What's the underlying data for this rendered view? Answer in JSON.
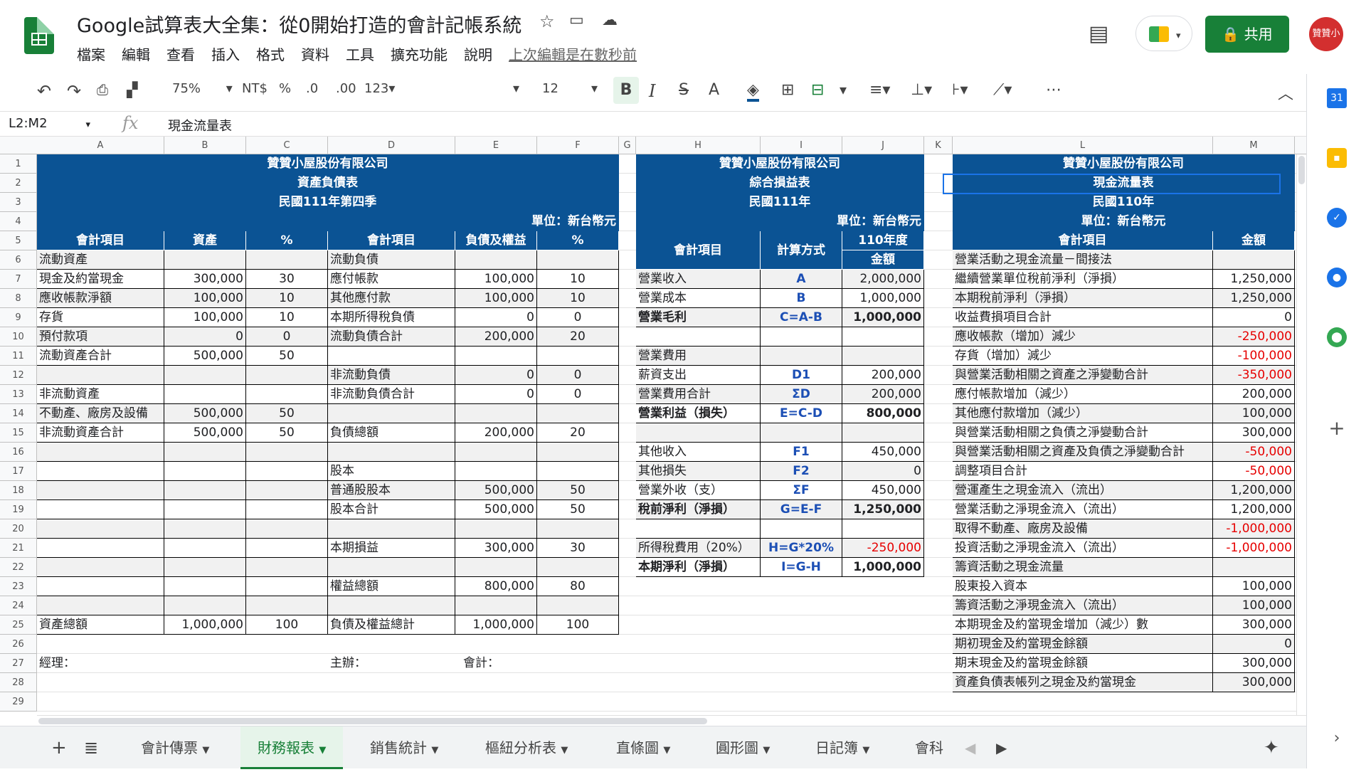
{
  "doc": {
    "title": "Google試算表大全集：從0開始打造的會計記帳系統",
    "menus": [
      "檔案",
      "編輯",
      "查看",
      "插入",
      "格式",
      "資料",
      "工具",
      "擴充功能",
      "說明"
    ],
    "last_edit": "上次編輯是在數秒前",
    "share": "共用",
    "avatar": "贊贊小屋"
  },
  "toolbar": {
    "zoom": "75%",
    "currency": "NT$",
    "percent": "%",
    "dec_less": ".0",
    "dec_more": ".00",
    "num_fmt": "123",
    "font": "",
    "font_size": "12",
    "bold": "B",
    "italic": "I",
    "strike": "S",
    "text_color": "A",
    "more": "⋯"
  },
  "formula_bar": {
    "name_box": "L2:M2",
    "fx": "fx",
    "value": "現金流量表"
  },
  "columns": [
    "A",
    "B",
    "C",
    "D",
    "E",
    "F",
    "G",
    "H",
    "I",
    "J",
    "K",
    "L",
    "M"
  ],
  "rows": [
    "1",
    "2",
    "3",
    "4",
    "5",
    "6",
    "7",
    "8",
    "9",
    "10",
    "11",
    "12",
    "13",
    "14",
    "15",
    "16",
    "17",
    "18",
    "19",
    "20",
    "21",
    "22",
    "23",
    "24",
    "25",
    "26",
    "27",
    "28",
    "29"
  ],
  "balance": {
    "company": "贊贊小屋股份有限公司",
    "title": "資產負債表",
    "period": "民國111年第四季",
    "unit": "單位：新台幣元",
    "headers": [
      "會計項目",
      "資產",
      "%",
      "會計項目",
      "負債及權益",
      "%"
    ],
    "rows": [
      [
        "流動資產",
        "",
        "",
        "流動負債",
        "",
        ""
      ],
      [
        "現金及約當現金",
        "300,000",
        "30",
        "應付帳款",
        "100,000",
        "10"
      ],
      [
        "應收帳款淨額",
        "100,000",
        "10",
        "其他應付款",
        "100,000",
        "10"
      ],
      [
        "存貨",
        "100,000",
        "10",
        "本期所得稅負債",
        "0",
        "0"
      ],
      [
        "預付款項",
        "0",
        "0",
        "流動負債合計",
        "200,000",
        "20"
      ],
      [
        "流動資產合計",
        "500,000",
        "50",
        "",
        "",
        ""
      ],
      [
        "",
        "",
        "",
        "非流動負債",
        "0",
        "0"
      ],
      [
        "非流動資產",
        "",
        "",
        "非流動負債合計",
        "0",
        "0"
      ],
      [
        "不動產、廠房及設備",
        "500,000",
        "50",
        "",
        "",
        ""
      ],
      [
        "非流動資產合計",
        "500,000",
        "50",
        "負債總額",
        "200,000",
        "20"
      ],
      [
        "",
        "",
        "",
        "",
        "",
        ""
      ],
      [
        "",
        "",
        "",
        "股本",
        "",
        ""
      ],
      [
        "",
        "",
        "",
        "普通股股本",
        "500,000",
        "50"
      ],
      [
        "",
        "",
        "",
        "股本合計",
        "500,000",
        "50"
      ],
      [
        "",
        "",
        "",
        "",
        "",
        ""
      ],
      [
        "",
        "",
        "",
        "本期損益",
        "300,000",
        "30"
      ],
      [
        "",
        "",
        "",
        "",
        "",
        ""
      ],
      [
        "",
        "",
        "",
        "權益總額",
        "800,000",
        "80"
      ],
      [
        "",
        "",
        "",
        "",
        "",
        ""
      ],
      [
        "資產總額",
        "1,000,000",
        "100",
        "負債及權益總計",
        "1,000,000",
        "100"
      ]
    ],
    "sign": [
      "經理：",
      "主辦：",
      "會計："
    ]
  },
  "income": {
    "company": "贊贊小屋股份有限公司",
    "title": "綜合損益表",
    "period": "民國111年",
    "unit": "單位：新台幣元",
    "year": "110年度",
    "headers": [
      "會計項目",
      "計算方式",
      "金額"
    ],
    "rows": [
      [
        "營業收入",
        "A",
        "2,000,000"
      ],
      [
        "營業成本",
        "B",
        "1,000,000"
      ],
      [
        "營業毛利",
        "C=A-B",
        "1,000,000"
      ],
      [
        "",
        "",
        ""
      ],
      [
        "營業費用",
        "",
        ""
      ],
      [
        "薪資支出",
        "D1",
        "200,000"
      ],
      [
        "營業費用合計",
        "ΣD",
        "200,000"
      ],
      [
        "營業利益（損失）",
        "E=C-D",
        "800,000"
      ],
      [
        "",
        "",
        ""
      ],
      [
        "其他收入",
        "F1",
        "450,000"
      ],
      [
        "其他損失",
        "F2",
        "0"
      ],
      [
        "營業外收（支）",
        "ΣF",
        "450,000"
      ],
      [
        "稅前淨利（淨損）",
        "G=E-F",
        "1,250,000"
      ],
      [
        "",
        "",
        ""
      ],
      [
        "所得稅費用（20%）",
        "H=G*20%",
        "-250,000"
      ],
      [
        "本期淨利（淨損）",
        "I=G-H",
        "1,000,000"
      ]
    ]
  },
  "cashflow": {
    "company": "贊贊小屋股份有限公司",
    "title": "現金流量表",
    "period": "民國110年",
    "unit": "單位：新台幣元",
    "headers": [
      "會計項目",
      "金額"
    ],
    "rows": [
      [
        "營業活動之現金流量－間接法",
        ""
      ],
      [
        "繼續營業單位稅前淨利（淨損）",
        "1,250,000"
      ],
      [
        "本期稅前淨利（淨損）",
        "1,250,000"
      ],
      [
        "收益費損項目合計",
        "0"
      ],
      [
        "應收帳款（增加）減少",
        "-250,000"
      ],
      [
        "存貨（增加）減少",
        "-100,000"
      ],
      [
        "與營業活動相關之資產之淨變動合計",
        "-350,000"
      ],
      [
        "應付帳款增加（減少）",
        "200,000"
      ],
      [
        "其他應付款增加（減少）",
        "100,000"
      ],
      [
        "與營業活動相關之負債之淨變動合計",
        "300,000"
      ],
      [
        "與營業活動相關之資產及負債之淨變動合計",
        "-50,000"
      ],
      [
        "調整項目合計",
        "-50,000"
      ],
      [
        "營運產生之現金流入（流出）",
        "1,200,000"
      ],
      [
        "營業活動之淨現金流入（流出）",
        "1,200,000"
      ],
      [
        "取得不動產、廠房及設備",
        "-1,000,000"
      ],
      [
        "投資活動之淨現金流入（流出）",
        "-1,000,000"
      ],
      [
        "籌資活動之現金流量",
        ""
      ],
      [
        "股東投入資本",
        "100,000"
      ],
      [
        "籌資活動之淨現金流入（流出）",
        "100,000"
      ],
      [
        "本期現金及約當現金增加（減少）數",
        "300,000"
      ],
      [
        "期初現金及約當現金餘額",
        "0"
      ],
      [
        "期末現金及約當現金餘額",
        "300,000"
      ],
      [
        "資產負債表帳列之現金及約當現金",
        "300,000"
      ]
    ]
  },
  "tabs": [
    "會計傳票",
    "財務報表",
    "銷售統計",
    "樞紐分析表",
    "直條圖",
    "圓形圖",
    "日記簿",
    "會科"
  ],
  "active_tab": "財務報表",
  "colors": {
    "header_blue": "#0b5394",
    "active_tab": "#188038",
    "negative": "#e60000",
    "formula": "#1c4fb5"
  },
  "side_icons": [
    "calendar-icon",
    "keep-icon",
    "tasks-icon",
    "contacts-icon",
    "maps-icon",
    "plus-icon"
  ]
}
